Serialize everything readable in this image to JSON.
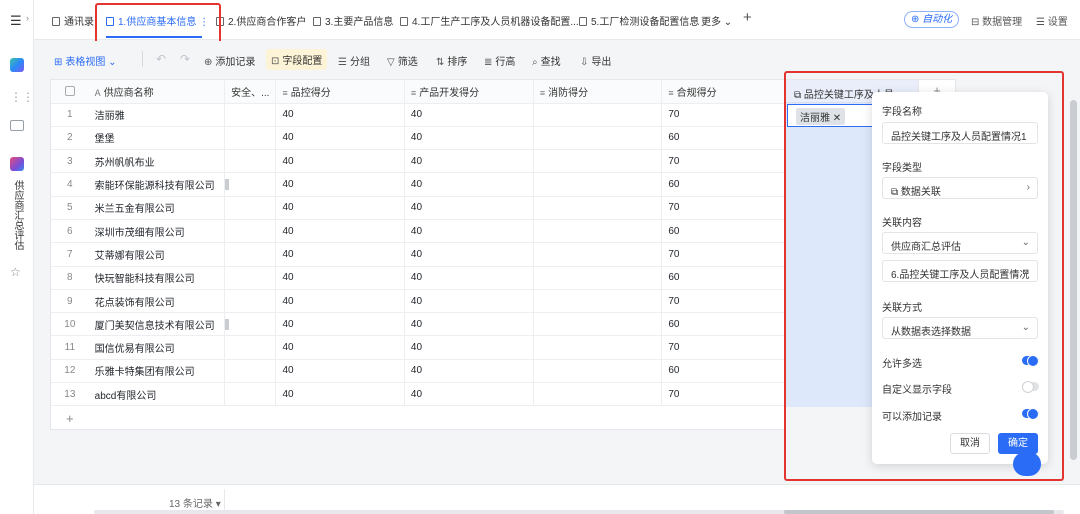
{
  "rail": {
    "app_title": "供应商汇总评估"
  },
  "tabs": [
    {
      "label": "通讯录"
    },
    {
      "label": "1.供应商基本信息"
    },
    {
      "label": "2.供应商合作客户"
    },
    {
      "label": "3.主要产品信息"
    },
    {
      "label": "4.工厂生产工序及人员机器设备配置..."
    },
    {
      "label": "5.工厂检测设备配置信息"
    }
  ],
  "tabbar": {
    "more_label": "更多",
    "auto_label": "自动化",
    "data_manage_label": "数据管理",
    "settings_label": "设置"
  },
  "toolbar": {
    "view_label": "表格视图",
    "add_record_label": "添加记录",
    "field_config_label": "字段配置",
    "group_label": "分组",
    "filter_label": "筛选",
    "sort_label": "排序",
    "row_height_label": "行高",
    "find_label": "查找",
    "export_label": "导出"
  },
  "table": {
    "columns": [
      "供应商名称",
      "安全、...",
      "品控得分",
      "产品开发得分",
      "消防得分",
      "合规得分"
    ],
    "rows": [
      {
        "idx": "1",
        "name": "洁丽雅",
        "qc": "40",
        "dev": "40",
        "fire": "",
        "comp": "70"
      },
      {
        "idx": "2",
        "name": "堡堡",
        "qc": "40",
        "dev": "40",
        "fire": "",
        "comp": "60"
      },
      {
        "idx": "3",
        "name": "苏州帆帆布业",
        "qc": "40",
        "dev": "40",
        "fire": "",
        "comp": "70"
      },
      {
        "idx": "4",
        "name": "索能环保能源科技有限公司",
        "qc": "40",
        "dev": "40",
        "fire": "",
        "comp": "60"
      },
      {
        "idx": "5",
        "name": "米兰五金有限公司",
        "qc": "40",
        "dev": "40",
        "fire": "",
        "comp": "70"
      },
      {
        "idx": "6",
        "name": "深圳市茂细有限公司",
        "qc": "40",
        "dev": "40",
        "fire": "",
        "comp": "60"
      },
      {
        "idx": "7",
        "name": "艾蒂娜有限公司",
        "qc": "40",
        "dev": "40",
        "fire": "",
        "comp": "70"
      },
      {
        "idx": "8",
        "name": "快玩智能科技有限公司",
        "qc": "40",
        "dev": "40",
        "fire": "",
        "comp": "60"
      },
      {
        "idx": "9",
        "name": "花点装饰有限公司",
        "qc": "40",
        "dev": "40",
        "fire": "",
        "comp": "70"
      },
      {
        "idx": "10",
        "name": "厦门美契信息技术有限公司",
        "qc": "40",
        "dev": "40",
        "fire": "",
        "comp": "60"
      },
      {
        "idx": "11",
        "name": "国信优易有限公司",
        "qc": "40",
        "dev": "40",
        "fire": "",
        "comp": "70"
      },
      {
        "idx": "12",
        "name": "乐雅卡特集团有限公司",
        "qc": "40",
        "dev": "40",
        "fire": "",
        "comp": "60"
      },
      {
        "idx": "13",
        "name": "abcd有限公司",
        "qc": "40",
        "dev": "40",
        "fire": "",
        "comp": "70"
      }
    ],
    "add_row_label": "+"
  },
  "linked_column": {
    "header": "品控关键工序及人员...",
    "chip": "洁丽雅"
  },
  "panel": {
    "field_name_label": "字段名称",
    "field_name_value": "品控关键工序及人员配置情况1",
    "field_type_label": "字段类型",
    "field_type_value": "数据关联",
    "link_content_label": "关联内容",
    "link_app_value": "供应商汇总评估",
    "link_form_value": "6.品控关键工序及人员配置情况",
    "link_mode_label": "关联方式",
    "link_mode_value": "从数据表选择数据",
    "allow_multi_label": "允许多选",
    "allow_multi_on": true,
    "custom_display_label": "自定义显示字段",
    "custom_display_on": false,
    "allow_add_label": "可以添加记录",
    "allow_add_on": true,
    "cancel_label": "取消",
    "confirm_label": "确定"
  },
  "footer": {
    "record_count": "13 条记录"
  },
  "colors": {
    "accent": "#2b6cf6",
    "highlight_box": "#e3342f"
  }
}
